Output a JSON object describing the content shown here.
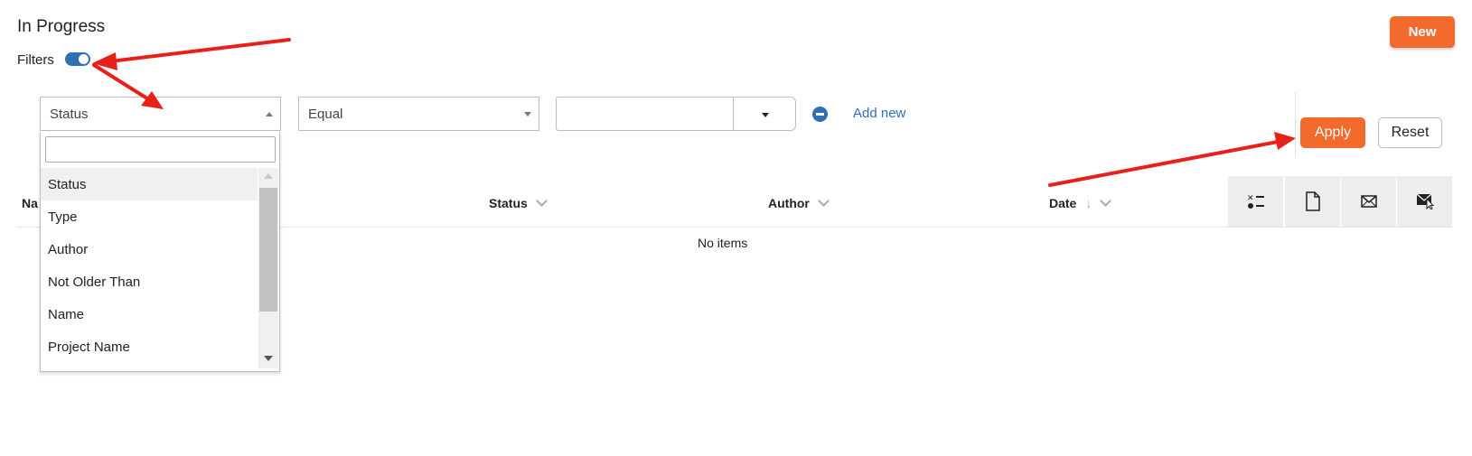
{
  "header": {
    "title": "In Progress",
    "new_button": "New"
  },
  "filters": {
    "label": "Filters",
    "enabled": true,
    "field_select": "Status",
    "operator_select": "Equal",
    "value": "",
    "add_new": "Add new",
    "apply_label": "Apply",
    "reset_label": "Reset"
  },
  "dropdown": {
    "search_value": "",
    "options": [
      "Status",
      "Type",
      "Author",
      "Not Older Than",
      "Name",
      "Project Name"
    ],
    "highlighted": "Status"
  },
  "table": {
    "columns": {
      "name": "Na",
      "status": "Status",
      "author": "Author",
      "date": "Date"
    },
    "empty_text": "No items",
    "actions": [
      "checklist-icon",
      "document-icon",
      "envelope-icon",
      "envelope-filled-icon"
    ]
  },
  "colors": {
    "accent": "#f26b2c",
    "link": "#2f6fb3",
    "annotation_arrow": "#e8201a"
  }
}
